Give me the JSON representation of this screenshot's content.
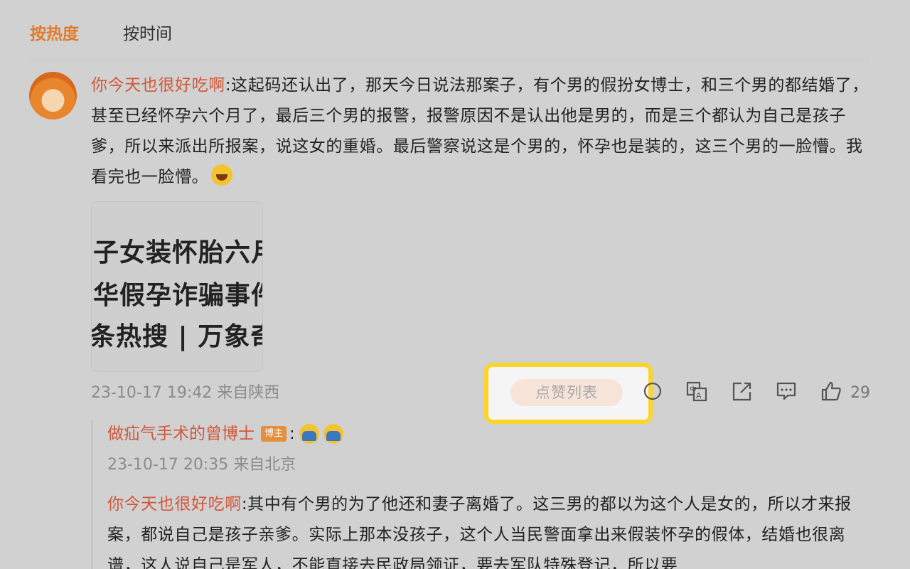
{
  "sort_tabs": [
    {
      "label": "按热度",
      "active": true
    },
    {
      "label": "按时间",
      "active": false
    }
  ],
  "comment": {
    "author": "你今天也很好吃啊",
    "separator": ":",
    "text": "这起码还认出了，那天今日说法那案子，有个男的假扮女博士，和三个男的都结婚了，甚至已经怀孕六个月了，最后三个男的报警，报警原因不是认出他是男的，而是三个都认为自己是孩子爹，所以来派出所报案，说这女的重婚。最后警察说这是个男的，怀孕也是装的，这三个男的一脸懵。我看完也一脸懵。",
    "emoji": "laugh-emoji",
    "image_lines": [
      "子女装怀胎六月",
      "华假孕诈骗事件",
      "条热搜 | 万象奇"
    ],
    "time_location": "23-10-17 19:42 来自陕西",
    "like_list_label": "点赞列表",
    "like_count": "29",
    "icons": [
      "reply-icon",
      "translate-icon",
      "share-icon",
      "comment-icon",
      "like-icon"
    ]
  },
  "reply": {
    "author": "做疝气手术的曾博士",
    "badge": "博主",
    "colon": ":",
    "emojis": [
      "facepalm-emoji",
      "facepalm-emoji"
    ],
    "time_location": "23-10-17 20:35 来自北京",
    "quoted_author": "你今天也很好吃啊",
    "separator": ":",
    "text": "其中有个男的为了他还和妻子离婚了。这三男的都以为这个人是女的，所以才来报案，都说自己是孩子亲爹。实际上那本没孩子，这个人当民警面拿出来假装怀孕的假体，结婚也很离谱，这人说自己是军人，不能直接去民政局领证，要去军队特殊登记，所以要"
  },
  "colors": {
    "accent": "#e07b2a",
    "username": "#d0583a",
    "highlight": "#fcd52a"
  }
}
